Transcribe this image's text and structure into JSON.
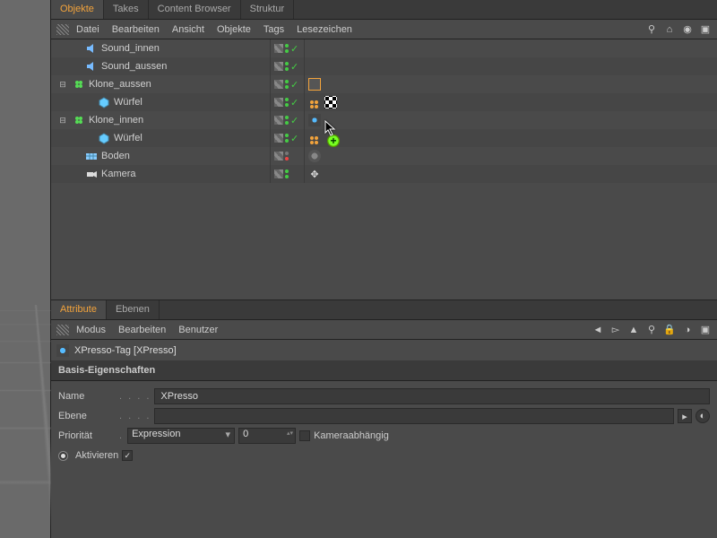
{
  "tabs": {
    "objects": "Objekte",
    "takes": "Takes",
    "content": "Content Browser",
    "structure": "Struktur"
  },
  "menu": {
    "file": "Datei",
    "edit": "Bearbeiten",
    "view": "Ansicht",
    "objects": "Objekte",
    "tags": "Tags",
    "bookmarks": "Lesezeichen"
  },
  "tree": [
    {
      "name": "Sound_innen",
      "indent": 1,
      "icon": "speaker",
      "exp": "",
      "chk": true,
      "tags": []
    },
    {
      "name": "Sound_aussen",
      "indent": 1,
      "icon": "speaker",
      "exp": "",
      "chk": true,
      "tags": []
    },
    {
      "name": "Klone_aussen",
      "indent": 0,
      "icon": "cloner",
      "exp": "⊟",
      "chk": true,
      "tags": [
        "xpresso-sel"
      ]
    },
    {
      "name": "Würfel",
      "indent": 2,
      "icon": "cube",
      "exp": "",
      "chk": true,
      "tags": [
        "dots",
        "checker"
      ]
    },
    {
      "name": "Klone_innen",
      "indent": 0,
      "icon": "cloner",
      "exp": "⊟",
      "chk": true,
      "tags": [
        "xpresso"
      ]
    },
    {
      "name": "Würfel",
      "indent": 2,
      "icon": "cube",
      "exp": "",
      "chk": true,
      "tags": [
        "dots"
      ]
    },
    {
      "name": "Boden",
      "indent": 1,
      "icon": "floor",
      "exp": "",
      "dotred": true,
      "tags": [
        "comp"
      ]
    },
    {
      "name": "Kamera",
      "indent": 1,
      "icon": "camera",
      "exp": "",
      "tags": [
        "target"
      ]
    }
  ],
  "attr_tabs": {
    "attribute": "Attribute",
    "layers": "Ebenen"
  },
  "attr_menu": {
    "mode": "Modus",
    "edit": "Bearbeiten",
    "user": "Benutzer"
  },
  "tag_header": "XPresso-Tag [XPresso]",
  "section": "Basis-Eigenschaften",
  "fields": {
    "name_label": "Name",
    "name_value": "XPresso",
    "layer_label": "Ebene",
    "layer_value": "",
    "priority_label": "Priorität",
    "priority_mode": "Expression",
    "priority_value": "0",
    "camdep_label": "Kameraabhängig",
    "enable_label": "Aktivieren"
  }
}
